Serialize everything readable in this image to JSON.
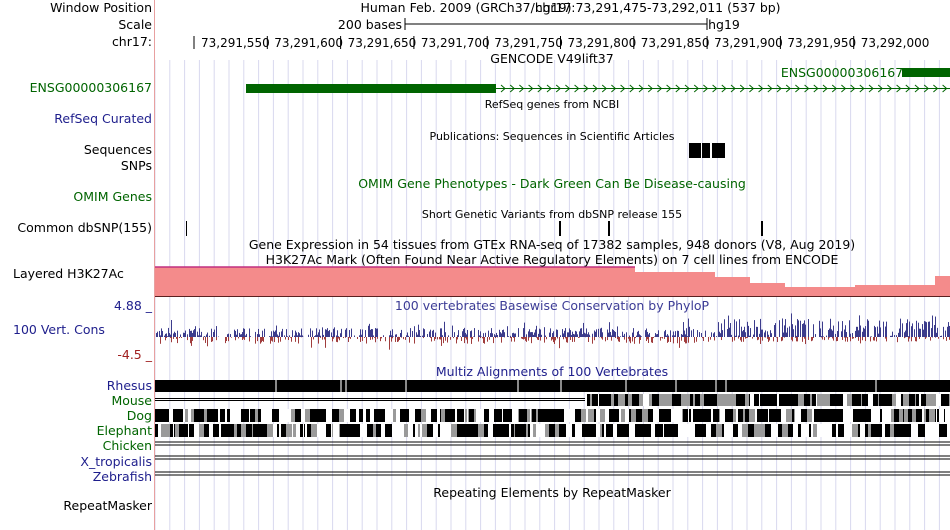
{
  "header": {
    "window_position_label": "Window Position",
    "scale_label": "Scale",
    "chrom_label": "chr17:",
    "assembly": "Human Feb. 2009 (GRCh37/hg19)",
    "position": "chr17:73,291,475-73,292,011 (537 bp)",
    "scale_text": "200 bases",
    "scale_db": "hg19",
    "ruler_ticks": [
      "73,291,550",
      "73,291,600",
      "73,291,650",
      "73,291,700",
      "73,291,750",
      "73,291,800",
      "73,291,850",
      "73,291,900",
      "73,291,950",
      "73,292,000"
    ]
  },
  "tracks": {
    "gencode": {
      "title": "GENCODE V49lift37",
      "left_label": "ENSG00000306167",
      "feature_label": "ENSG00000306167",
      "color": "#006400"
    },
    "refseq": {
      "title": "RefSeq genes from NCBI",
      "left_label": "RefSeq Curated",
      "color": "#0c0c78"
    },
    "publications": {
      "title": "Publications: Sequences in Scientific Articles",
      "left_label_1": "Sequences",
      "left_label_2": "SNPs"
    },
    "omim": {
      "title": "OMIM Gene Phenotypes - Dark Green Can Be Disease-causing",
      "left_label": "OMIM Genes",
      "color": "#006400"
    },
    "dbsnp": {
      "title": "Short Genetic Variants from dbSNP release 155",
      "left_label": "Common dbSNP(155)"
    },
    "gtex": {
      "title": "Gene Expression in 54 tissues from GTEx RNA-seq of 17382 samples, 948 donors (V8, Aug 2019)"
    },
    "h3k27ac": {
      "title": "H3K27Ac Mark (Often Found Near Active Regulatory Elements) on 7 cell lines from ENCODE",
      "left_label": "Layered H3K27Ac",
      "fill_color": "#f48b8b"
    },
    "conservation": {
      "title": "100 vertebrates Basewise Conservation by PhyloP",
      "left_label": "100 Vert. Cons",
      "max_label": "4.88 _",
      "min_label": "-4.5 _",
      "pos_color": "#3c3c8c",
      "neg_color": "#a03c3c"
    },
    "multiz": {
      "title": "Multiz Alignments of 100 Vertebrates",
      "species": [
        "Rhesus",
        "Mouse",
        "Dog",
        "Elephant",
        "Chicken",
        "X_tropicalis",
        "Zebrafish"
      ]
    },
    "repeatmasker": {
      "title": "Repeating Elements by RepeatMasker",
      "left_label": "RepeatMasker"
    }
  },
  "colors": {
    "grid": "#c8c8e6",
    "label_blue": "#1e1e8c",
    "label_green": "#006400",
    "conservation_blue": "#3c3c96"
  }
}
